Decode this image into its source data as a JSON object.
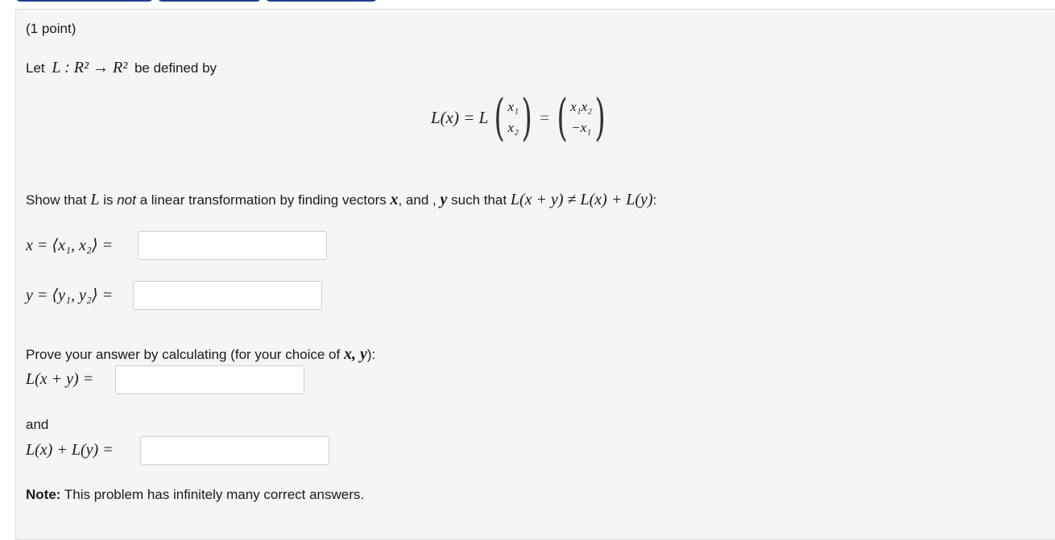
{
  "problem": {
    "points": "(1 point)",
    "intro_prefix": "Let",
    "intro_map": "L : R² → R²",
    "intro_suffix": "be defined by",
    "display_lhs": "L(x) = L",
    "vec_in_top": "x₁",
    "vec_in_bottom": "x₂",
    "vec_out_top": "x₁x₂",
    "vec_out_bottom": "−x₁",
    "show_part1": "Show that",
    "show_part2": "is",
    "show_not": "not",
    "show_part3": "a linear transformation by finding vectors",
    "show_part4": ", and ,",
    "show_part5": "such that",
    "show_inequality": "L(x + y) ≠ L(x) + L(y)",
    "show_colon": ":"
  },
  "fields": {
    "x_label": "x = ⟨x₁, x₂⟩ =",
    "y_label": "y = ⟨y₁, y₂⟩ =",
    "prove_text": "Prove your answer by calculating (for your choice of",
    "prove_vars": "x, y",
    "prove_close": "):",
    "sum_label": "L(x + y) =",
    "and_text": "and",
    "split_label": "L(x) + L(y) =",
    "x_value": "",
    "y_value": "",
    "sum_value": "",
    "split_value": ""
  },
  "note": {
    "bold": "Note:",
    "text": " This problem has infinitely many correct answers."
  }
}
